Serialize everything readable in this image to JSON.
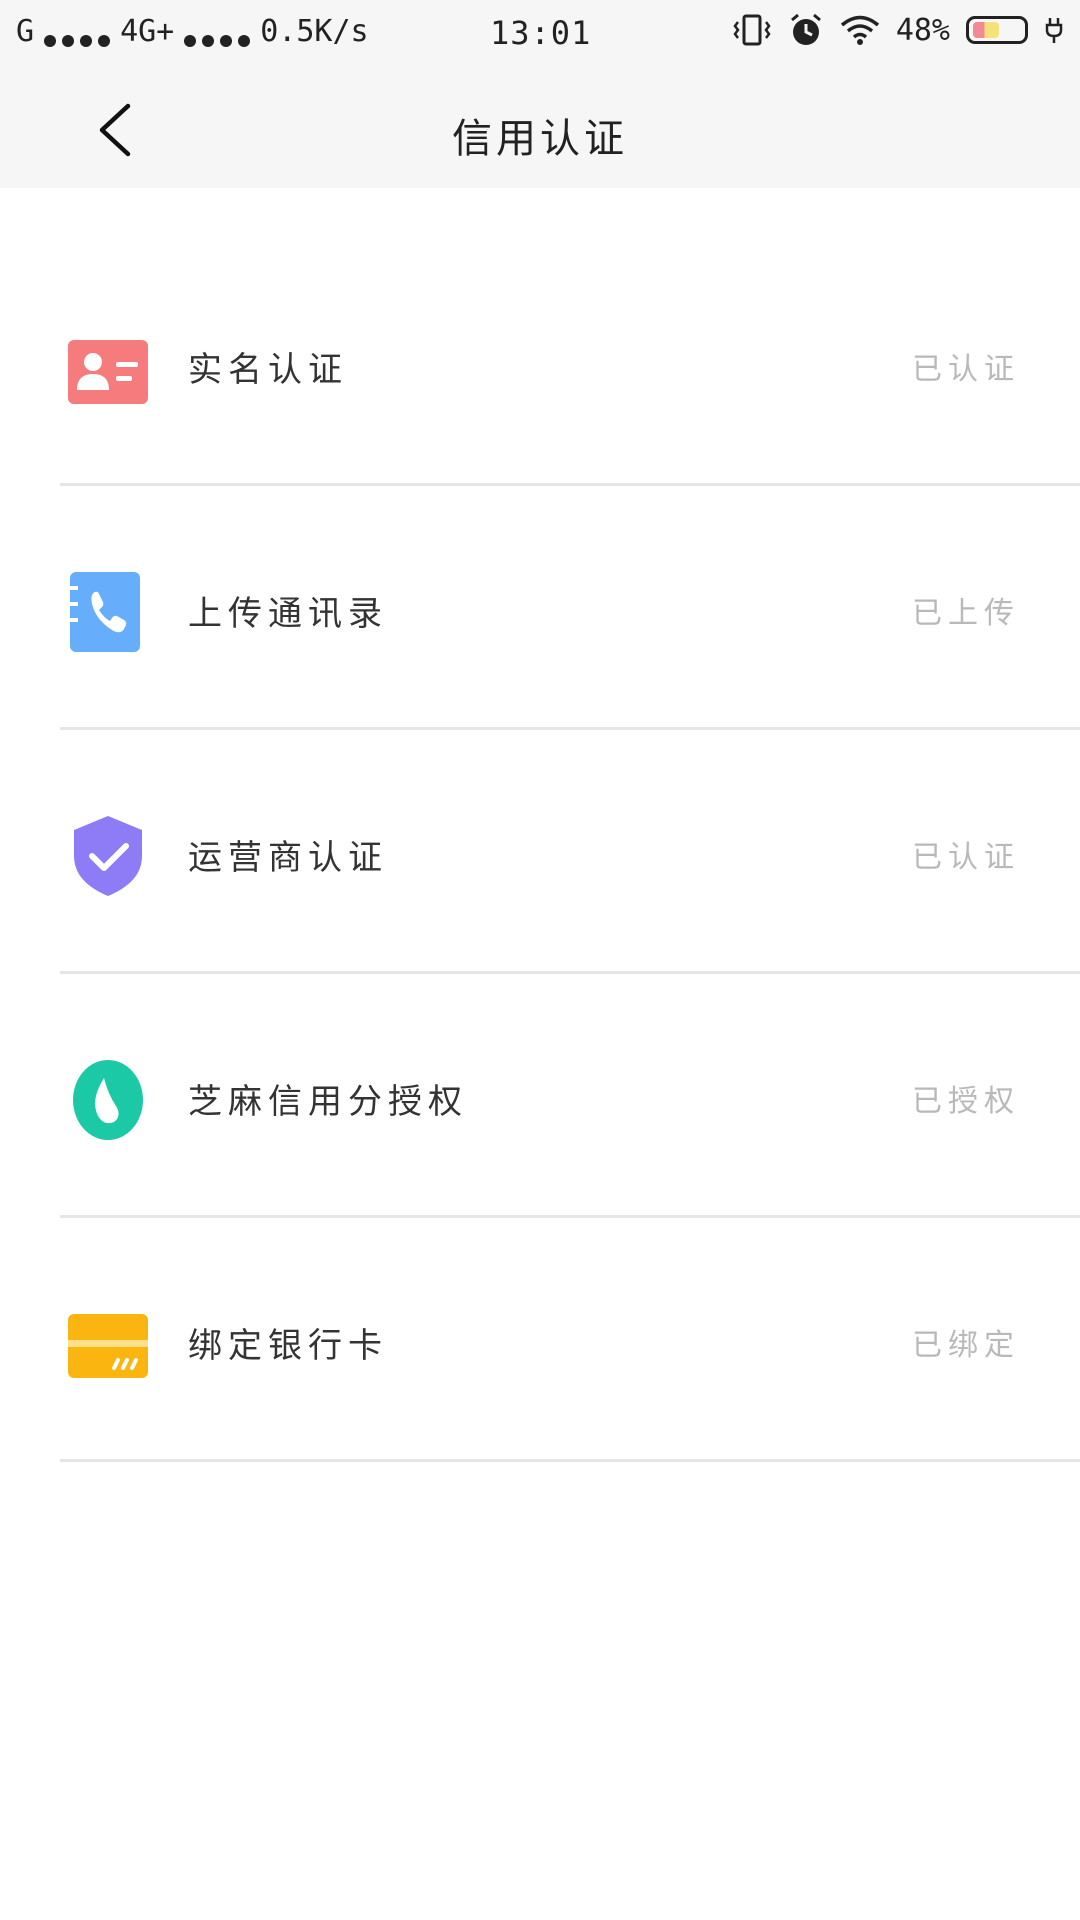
{
  "status_bar": {
    "carrier": "G",
    "network": "4G+",
    "speed": "0.5K/s",
    "time": "13:01",
    "battery": "48%",
    "icons": [
      "vibrate-icon",
      "alarm-icon",
      "wifi-icon",
      "battery-icon",
      "charging-icon"
    ]
  },
  "nav": {
    "title": "信用认证",
    "back_icon": "chevron-left-icon"
  },
  "items": [
    {
      "label": "实名认证",
      "status": "已认证",
      "icon": "id-card-icon",
      "color": "#f67b7c"
    },
    {
      "label": "上传通讯录",
      "status": "已上传",
      "icon": "contacts-phone-icon",
      "color": "#66aefc"
    },
    {
      "label": "运营商认证",
      "status": "已认证",
      "icon": "shield-check-icon",
      "color": "#8e7cf6"
    },
    {
      "label": "芝麻信用分授权",
      "status": "已授权",
      "icon": "sesame-credit-icon",
      "color": "#1cc9a6"
    },
    {
      "label": "绑定银行卡",
      "status": "已绑定",
      "icon": "bank-card-icon",
      "color": "#fbb510"
    }
  ]
}
